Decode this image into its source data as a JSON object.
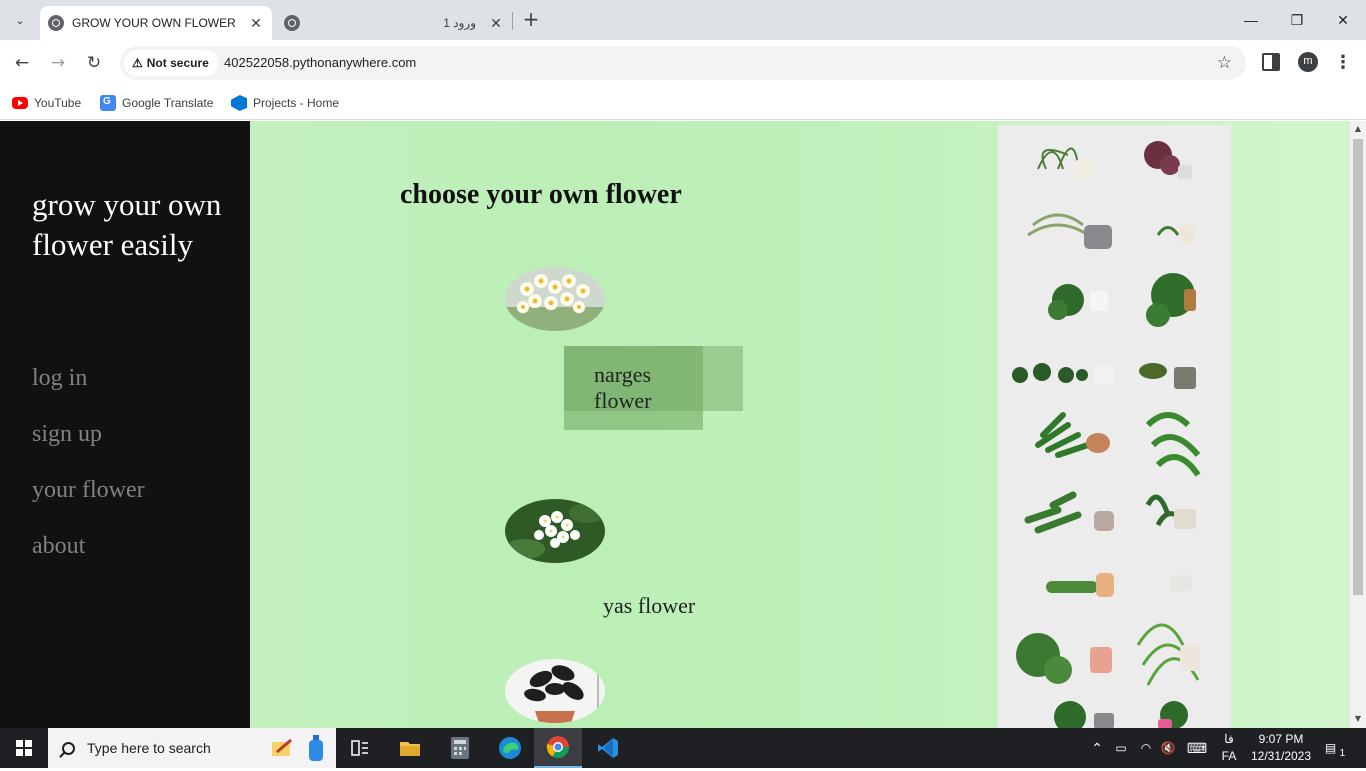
{
  "browser": {
    "active_tab": {
      "title": "GROW YOUR OWN FLOWER",
      "close": "✕"
    },
    "inactive_tab": {
      "title": "ورود 1",
      "close": "✕"
    },
    "new_tab": "+",
    "window_controls": {
      "minimize": "—",
      "restore": "❐",
      "close": "✕"
    },
    "security_label": "Not secure",
    "url": "402522058.pythonanywhere.com",
    "profile_initial": "m",
    "bookmarks": [
      {
        "label": "YouTube",
        "icon": "youtube-icon"
      },
      {
        "label": "Google Translate",
        "icon": "google-translate-icon"
      },
      {
        "label": "Projects - Home",
        "icon": "azure-devops-icon"
      }
    ]
  },
  "page": {
    "sidebar": {
      "brand": "grow your own flower easily",
      "links": [
        "log in",
        "sign up",
        "your flower",
        "about"
      ]
    },
    "heading": "choose your own flower",
    "flowers": [
      {
        "name_line1": "narges",
        "name_line2": "flower",
        "image": "narcissus-flowers-photo"
      },
      {
        "name_line1": "yas flower",
        "name_line2": "",
        "image": "jasmine-flowers-photo"
      },
      {
        "name_line1": "",
        "name_line2": "",
        "image": "dark-leaf-potted-plant-photo"
      }
    ],
    "side_image": "potted-houseplants-collage"
  },
  "taskbar": {
    "search_placeholder": "Type here to search",
    "apps": [
      "sticky-notes-icon",
      "bottle-app-icon",
      "task-view-icon",
      "file-explorer-icon",
      "calculator-icon",
      "edge-icon",
      "chrome-icon",
      "vscode-icon"
    ],
    "language_top": "فا",
    "language": "FA",
    "time": "9:07 PM",
    "date": "12/31/2023",
    "notification_count": "1"
  },
  "colors": {
    "sidebar_bg": "#111111",
    "main_bg": "#bfefba",
    "label_box": "#8ebf7e"
  }
}
